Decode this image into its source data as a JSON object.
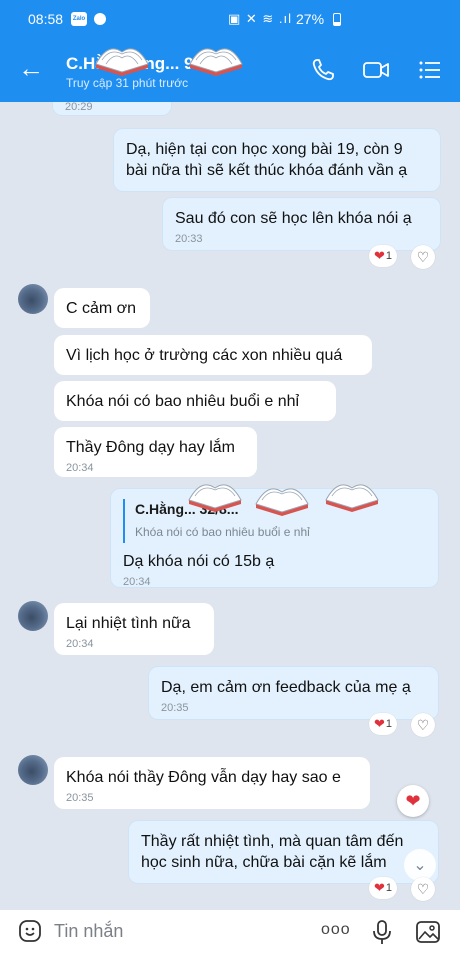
{
  "status_bar": {
    "time": "08:58",
    "app_badge": "Zalo",
    "system_icons": "▣ ✕ ≋ .ıl",
    "battery": "27%"
  },
  "header": {
    "name": "C.Hằng... ng... 98...",
    "subtitle": "Truy cập 31 phút trước",
    "icons": [
      "back-arrow-icon",
      "phone-icon",
      "video-icon",
      "menu-icon"
    ]
  },
  "messages": [
    {
      "side": "out",
      "time": "20:29"
    },
    {
      "side": "out",
      "text": "Dạ, hiện tại con học xong bài 19, còn 9 bài nữa thì sẽ kết thúc khóa đánh vần ạ"
    },
    {
      "side": "out",
      "text": "Sau đó con sẽ học lên khóa nói ạ",
      "time": "20:33",
      "reaction_count": "1"
    },
    {
      "side": "in",
      "text": "C cảm ơn"
    },
    {
      "side": "in",
      "text": "Vì lịch học ở trường các xon nhiều quá"
    },
    {
      "side": "in",
      "text": "Khóa nói có bao nhiêu buổi e nhỉ"
    },
    {
      "side": "in",
      "text": "Thầy Đông dạy hay lắm",
      "time": "20:34"
    },
    {
      "side": "out",
      "quote_name": "C.Hằng... 32/8...",
      "quote_text": "Khóa nói có bao nhiêu buổi e nhỉ",
      "text": "Dạ khóa nói có 15b ạ",
      "time": "20:34"
    },
    {
      "side": "in",
      "text": "Lại nhiệt tình nữa",
      "time": "20:34"
    },
    {
      "side": "out",
      "text": "Dạ, em cảm ơn feedback của mẹ ạ",
      "time": "20:35",
      "reaction_count": "1"
    },
    {
      "side": "in",
      "text": "Khóa nói thầy Đông vẫn dạy hay sao e",
      "time": "20:35"
    },
    {
      "side": "out",
      "text": "Thầy rất nhiệt tình, mà quan tâm đến học sinh nữa, chữa bài cặn kẽ lắm",
      "reaction_count": "1"
    }
  ],
  "composer": {
    "placeholder": "Tin nhắn",
    "more_label": "ooo"
  },
  "colors": {
    "header_blue": "#1f8ef1",
    "chat_bg": "#dfe5ee",
    "out_bubble": "#e2f1fd",
    "in_bubble": "#ffffff",
    "heart": "#e0323d"
  }
}
